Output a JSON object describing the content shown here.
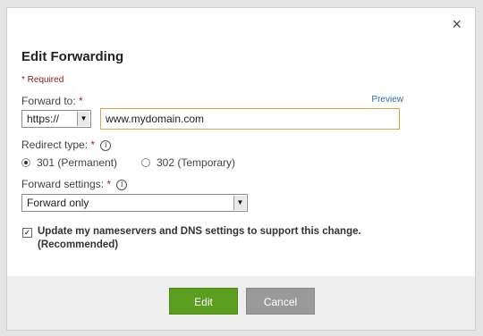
{
  "dialog": {
    "close_glyph": "×",
    "title": "Edit Forwarding",
    "required_note": "* Required"
  },
  "forward_to": {
    "label": "Forward to:",
    "required_mark": "*",
    "preview_link": "Preview",
    "protocol_selected": "https://",
    "url_value": "www.mydomain.com"
  },
  "redirect_type": {
    "label": "Redirect type:",
    "required_mark": "*",
    "options": [
      {
        "label": "301 (Permanent)",
        "checked": true
      },
      {
        "label": "302 (Temporary)",
        "checked": false
      }
    ]
  },
  "forward_settings": {
    "label": "Forward settings:",
    "required_mark": "*",
    "selected": "Forward only"
  },
  "update_dns": {
    "checked": true,
    "label": "Update my nameservers and DNS settings to support this change. (Recommended)"
  },
  "footer": {
    "edit_label": "Edit",
    "cancel_label": "Cancel"
  },
  "colors": {
    "edit_button": "#5b9e1f",
    "cancel_button": "#9a9a9a",
    "required_text": "#8b1a1a",
    "link": "#2e6da4",
    "input_focus_border": "#d0a84a"
  },
  "icons": {
    "close": "close-icon",
    "info": "info-icon",
    "dropdown": "chevron-down-icon"
  }
}
